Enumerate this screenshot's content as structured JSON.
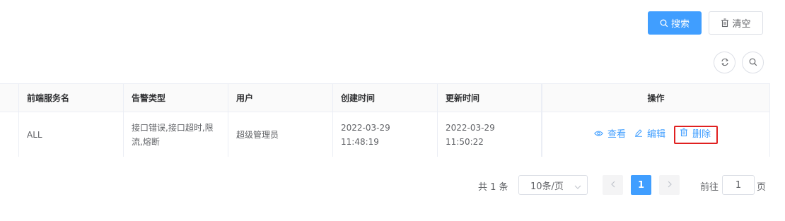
{
  "toolbar": {
    "search_label": "搜索",
    "clear_label": "清空",
    "search_icon": "search-icon",
    "clear_icon": "trash-icon"
  },
  "table_tools": {
    "refresh_icon": "refresh-icon",
    "search_icon": "search-icon"
  },
  "table": {
    "headers": [
      "",
      "前端服务名",
      "告警类型",
      "用户",
      "创建时间",
      "更新时间",
      "操作"
    ],
    "rows": [
      {
        "col0": "",
        "service": "ALL",
        "alert_type": "接口错误,接口超时,限流,熔断",
        "user": "超级管理员",
        "created": "2022-03-29 11:48:19",
        "updated": "2022-03-29 11:50:22",
        "actions": {
          "view": "查看",
          "edit": "编辑",
          "delete": "删除"
        }
      }
    ]
  },
  "pagination": {
    "total": "共 1 条",
    "page_size": "10条/页",
    "current_page": "1",
    "goto_label": "前往",
    "goto_value": "1",
    "page_suffix": "页"
  },
  "colors": {
    "primary": "#409eff",
    "highlight_border": "#e02020"
  }
}
